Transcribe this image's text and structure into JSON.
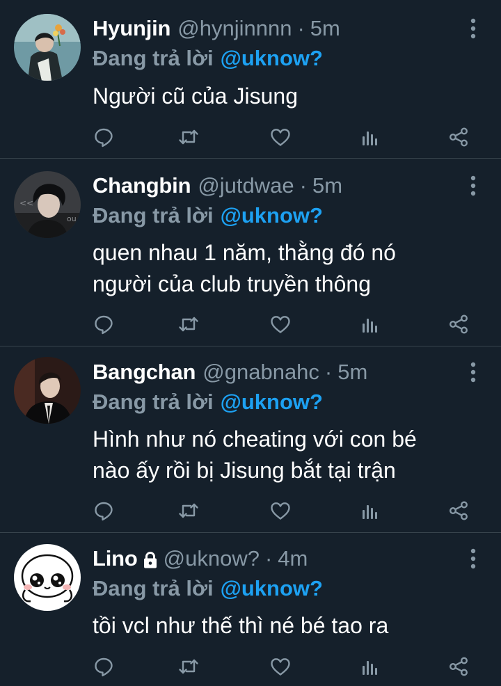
{
  "colors": {
    "background": "#15202b",
    "divider": "#38444d",
    "secondary_text": "#8899a6",
    "mention": "#1da1f2",
    "primary_text": "#ffffff"
  },
  "icons": {
    "more": "more-vertical-icon",
    "reply": "reply-icon",
    "retweet": "retweet-icon",
    "like": "heart-icon",
    "analytics": "analytics-icon",
    "share": "share-icon",
    "protected": "lock-icon"
  },
  "tweets": [
    {
      "name": "Hyunjin",
      "handle": "@hynjinnnn",
      "separator": "·",
      "time": "5m",
      "replying_prefix": "Đang trả lời",
      "replying_to": "@uknow?",
      "text_lines": [
        "Người cũ của Jisung"
      ]
    },
    {
      "name": "Changbin",
      "handle": "@jutdwae",
      "separator": "·",
      "time": "5m",
      "replying_prefix": "Đang trả lời",
      "replying_to": "@uknow?",
      "text_lines": [
        "quen nhau 1 năm, thằng đó nó",
        "người của club truyền thông"
      ]
    },
    {
      "name": "Bangchan",
      "handle": "@gnabnahc",
      "separator": "·",
      "time": "5m",
      "replying_prefix": "Đang trả lời",
      "replying_to": "@uknow?",
      "text_lines": [
        "Hình như nó cheating với con bé",
        "nào ấy rồi bị Jisung bắt tại trận"
      ]
    },
    {
      "name": "Lino",
      "protected": true,
      "handle": "@uknow?",
      "separator": "·",
      "time": "4m",
      "replying_prefix": "Đang trả lời",
      "replying_to": "@uknow?",
      "text_lines": [
        "tồi vcl như thế thì né bé tao ra"
      ]
    }
  ]
}
